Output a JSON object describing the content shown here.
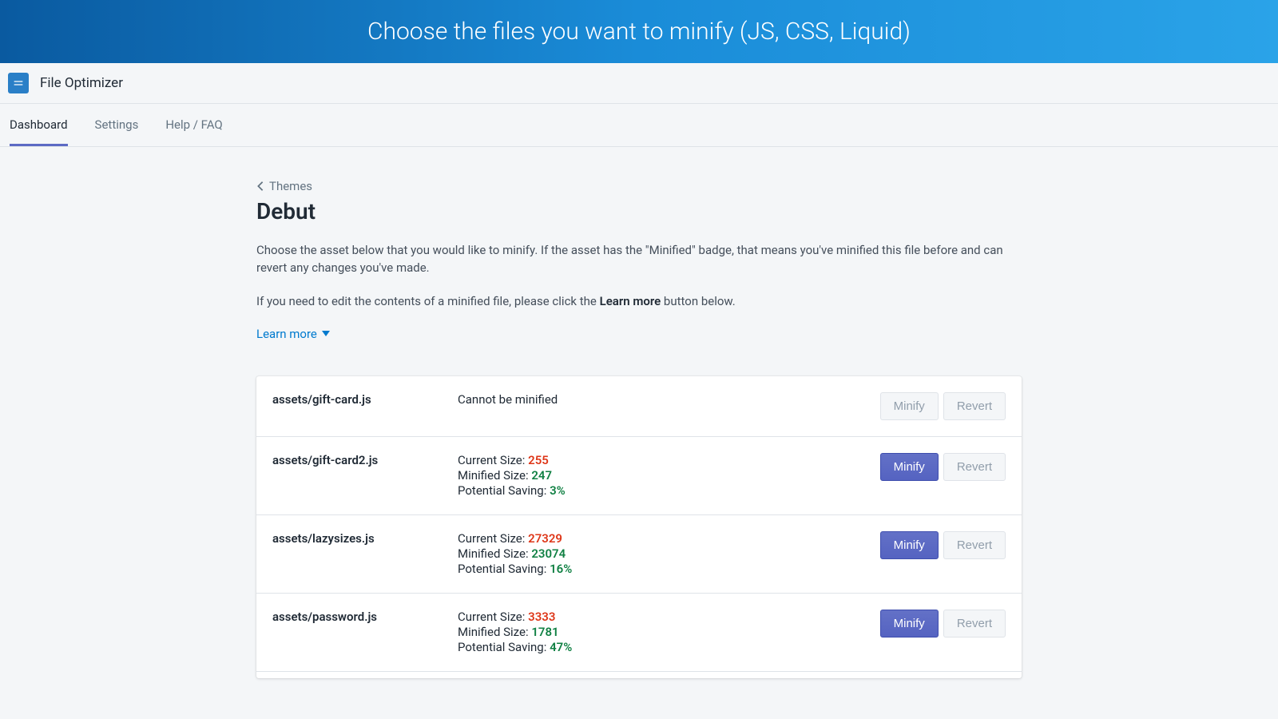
{
  "banner": {
    "text": "Choose the files you want to minify (JS, CSS, Liquid)"
  },
  "app": {
    "title": "File Optimizer"
  },
  "tabs": [
    {
      "label": "Dashboard",
      "active": true
    },
    {
      "label": "Settings",
      "active": false
    },
    {
      "label": "Help / FAQ",
      "active": false
    }
  ],
  "breadcrumb": {
    "label": "Themes"
  },
  "page": {
    "title": "Debut"
  },
  "desc": {
    "p1": "Choose the asset below that you would like to minify. If the asset has the \"Minified\" badge, that means you've minified this file before and can revert any changes you've made.",
    "p2a": "If you need to edit the contents of a minified file, please click the ",
    "p2b": "Learn more",
    "p2c": " button below."
  },
  "learn_more": "Learn more",
  "labels": {
    "current_size": "Current Size: ",
    "minified_size": "Minified Size: ",
    "potential_saving": "Potential Saving: ",
    "minify": "Minify",
    "revert": "Revert",
    "cannot_minify": "Cannot be minified"
  },
  "rows": [
    {
      "name": "assets/gift-card.js",
      "status": "cannot"
    },
    {
      "name": "assets/gift-card2.js",
      "current": "255",
      "minified": "247",
      "saving": "3%"
    },
    {
      "name": "assets/lazysizes.js",
      "current": "27329",
      "minified": "23074",
      "saving": "16%"
    },
    {
      "name": "assets/password.js",
      "current": "3333",
      "minified": "1781",
      "saving": "47%"
    }
  ]
}
